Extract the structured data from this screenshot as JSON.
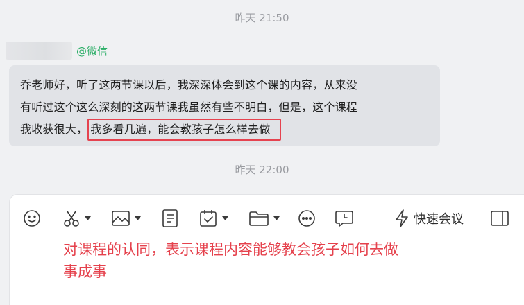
{
  "chat": {
    "timestamp_1": "昨天 21:50",
    "timestamp_2": "昨天 22:00",
    "sender_suffix": "@微信",
    "message_lines": [
      "乔老师好，听了这两节课以后，我深深体会到这个课的内容，从来没",
      "有听过这个这么深刻的这两节课我虽然有些不明白，但是，这个课程",
      "我收获很大，"
    ],
    "highlighted_text": "我多看几遍，能会教孩子怎么样去做"
  },
  "toolbar": {
    "icons": [
      "emoji-icon",
      "scissors-icon",
      "image-icon",
      "document-icon",
      "calendar-check-icon",
      "folder-icon",
      "more-icon",
      "chat-clock-icon",
      "lightning-icon",
      "sidebar-panel-icon"
    ],
    "quick_meeting_label": "快速会议"
  },
  "annotation": {
    "line_1": "对课程的认同，表示课程内容能够教会孩子如何去做",
    "line_2": "事成事",
    "color": "#e5414c"
  },
  "colors": {
    "background": "#f0f1f3",
    "bubble": "#e1e3e7",
    "highlight_border": "#e5434f",
    "sender_tag": "#2bae67"
  }
}
